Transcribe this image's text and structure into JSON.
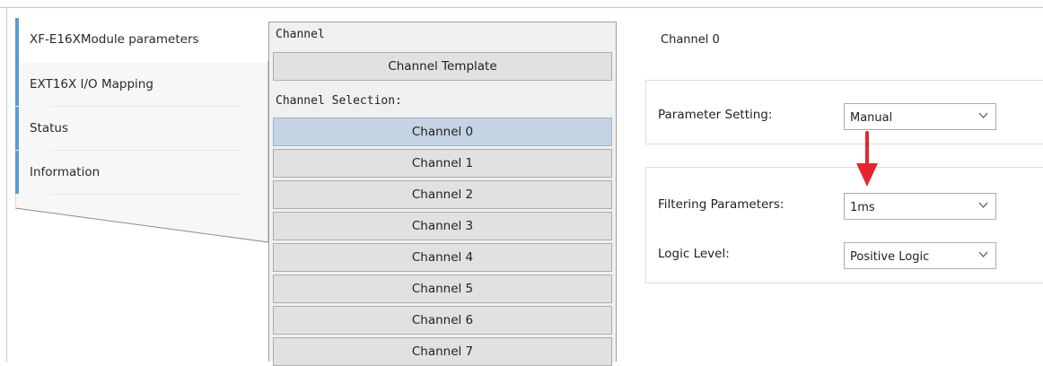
{
  "nav": {
    "items": [
      {
        "label": "XF-E16XModule parameters",
        "active": true
      },
      {
        "label": "EXT16X I/O Mapping",
        "active": false
      },
      {
        "label": "Status",
        "active": false
      },
      {
        "label": "Information",
        "active": false
      }
    ]
  },
  "channel_panel": {
    "header": "Channel",
    "template_label": "Channel Template",
    "selection_label": "Channel Selection:",
    "channels": [
      "Channel 0",
      "Channel 1",
      "Channel 2",
      "Channel 3",
      "Channel 4",
      "Channel 5",
      "Channel 6",
      "Channel 7"
    ],
    "selected": "Channel 0"
  },
  "details": {
    "title": "Channel 0",
    "parameter_setting": {
      "label": "Parameter Setting:",
      "value": "Manual"
    },
    "filtering": {
      "label": "Filtering Parameters:",
      "value": "1ms"
    },
    "logic_level": {
      "label": "Logic Level:",
      "value": "Positive Logic"
    }
  },
  "colors": {
    "accent": "#5b9bd5",
    "selected_channel": "#c4d4e2",
    "annotation_arrow": "#e3262e"
  }
}
